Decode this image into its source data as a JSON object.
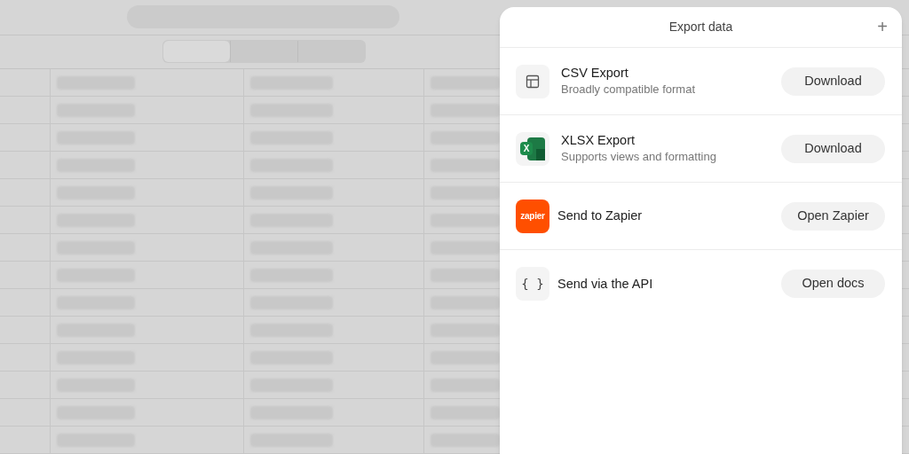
{
  "panel": {
    "title": "Export data",
    "close_symbol": "+"
  },
  "options": [
    {
      "kind": "table",
      "title": "CSV Export",
      "subtitle": "Broadly compatible format",
      "button": "Download"
    },
    {
      "kind": "excel",
      "icon_text": "X",
      "title": "XLSX Export",
      "subtitle": "Supports views and formatting",
      "button": "Download"
    },
    {
      "kind": "zapier",
      "icon_text": "zapier",
      "title": "Send to Zapier",
      "button": "Open Zapier"
    },
    {
      "kind": "braces",
      "icon_text": "{ }",
      "title": "Send via the API",
      "button": "Open docs"
    }
  ],
  "background": {
    "segments": [
      {
        "selected": true
      },
      {
        "selected": false
      },
      {
        "selected": false
      }
    ]
  }
}
